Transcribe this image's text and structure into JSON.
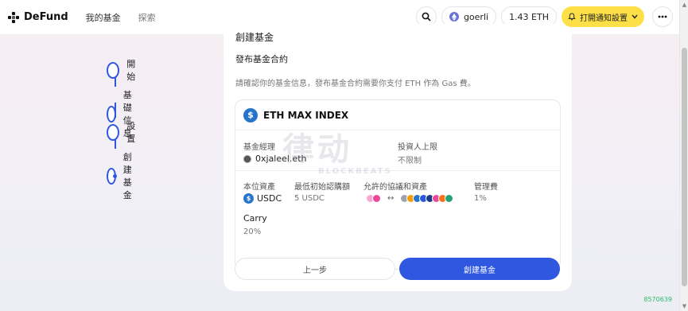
{
  "header": {
    "brand": "DeFund",
    "nav": [
      "我的基金",
      "探索"
    ],
    "network": "goerli",
    "balance": "1.43 ETH",
    "notify_label": "打開通知設置"
  },
  "steps": [
    {
      "label": "開始",
      "state": "done"
    },
    {
      "label": "基礎信息",
      "state": "done"
    },
    {
      "label": "設置",
      "state": "done"
    },
    {
      "label": "創建基金",
      "state": "current"
    }
  ],
  "card": {
    "title": "創建基金",
    "subtitle": "發布基金合約",
    "note": "請確認你的基金信息，發布基金合約需要你支付 ETH 作為 Gas 費。",
    "fund_name": "ETH MAX INDEX",
    "manager_label": "基金經理",
    "manager_value": "0xjaleel.eth",
    "investor_limit_label": "投資人上限",
    "investor_limit_value": "不限制",
    "base_asset_label": "本位資產",
    "base_asset_value": "USDC",
    "min_sub_label": "最低初始認購額",
    "min_sub_value": "5 USDC",
    "allowed_label": "允許的協議和資產",
    "mgmt_fee_label": "管理費",
    "mgmt_fee_value": "1%",
    "carry_label": "Carry",
    "carry_value": "20%",
    "back_label": "上一步",
    "create_label": "創建基金"
  },
  "watermark": {
    "main": "律动",
    "sub": "BLOCKBEATS"
  },
  "footer": {
    "build": "8570639"
  },
  "colors": {
    "accent": "#2f57e0",
    "notify": "#fde047",
    "usdc": "#2775ca"
  }
}
